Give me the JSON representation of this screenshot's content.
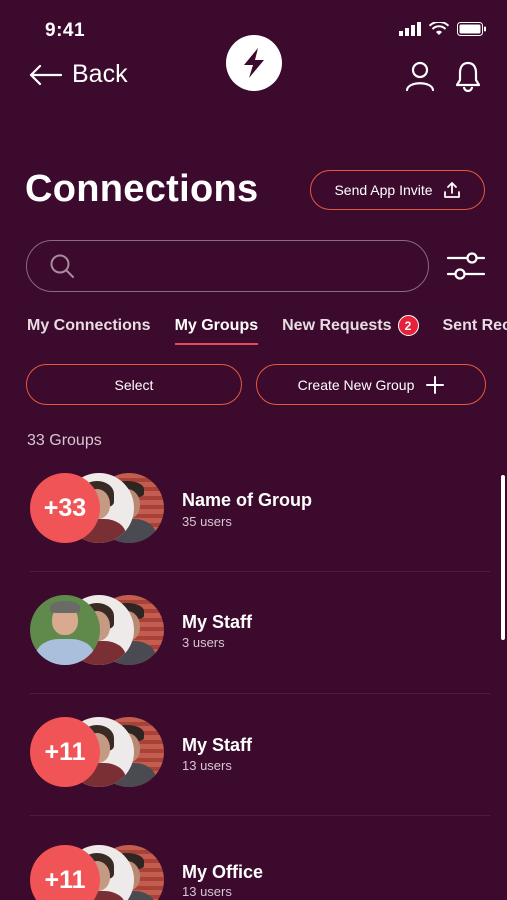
{
  "status": {
    "time": "9:41"
  },
  "nav": {
    "back_label": "Back"
  },
  "header": {
    "title": "Connections",
    "invite_label": "Send App Invite"
  },
  "search": {
    "placeholder": ""
  },
  "tabs": [
    {
      "label": "My Connections"
    },
    {
      "label": "My Groups",
      "active": true
    },
    {
      "label": "New Requests",
      "badge": "2"
    },
    {
      "label": "Sent Rec"
    }
  ],
  "actions": {
    "select_label": "Select",
    "create_label": "Create New Group"
  },
  "groups_count": "33 Groups",
  "groups": [
    {
      "more": "+33",
      "name": "Name of Group",
      "users": "35 users"
    },
    {
      "more": "",
      "name": "My Staff",
      "users": "3 users"
    },
    {
      "more": "+11",
      "name": "My Staff",
      "users": "13 users"
    },
    {
      "more": "+11",
      "name": "My Office",
      "users": "13 users"
    }
  ],
  "colors": {
    "background": "#3b0a2c",
    "accent": "#e8583e",
    "badge": "#e8213a",
    "avatar_more": "#f05456"
  },
  "icons": [
    "back-arrow-icon",
    "lightning-logo-icon",
    "user-icon",
    "bell-icon",
    "share-icon",
    "search-icon",
    "filter-sliders-icon",
    "plus-icon"
  ]
}
